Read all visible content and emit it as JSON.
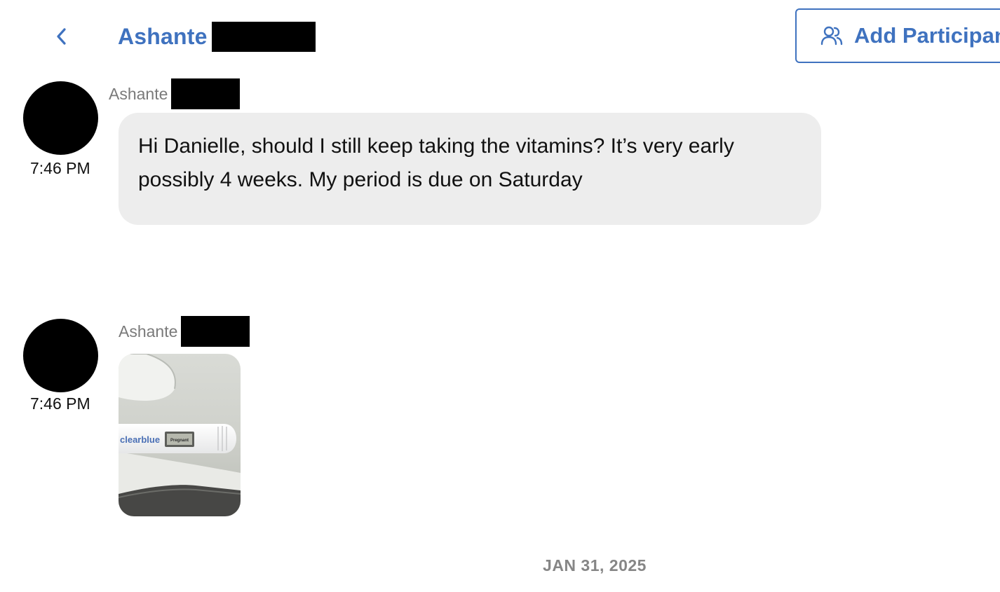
{
  "header": {
    "back_icon": "chevron-left-icon",
    "contact_name": "Ashante",
    "add_participant_icon": "users-icon",
    "add_participant_label": "Add Participant"
  },
  "messages": [
    {
      "sender": "Ashante",
      "time": "7:46 PM",
      "text": "Hi Danielle, should I still keep taking the vitamins? It’s very early possibly 4 weeks. My period is due on Saturday"
    },
    {
      "sender": "Ashante",
      "time": "7:46 PM",
      "attachment": {
        "type": "image",
        "brand_text": "clearblue",
        "display_text": "Pregnant"
      }
    }
  ],
  "date_separator": "JAN 31, 2025",
  "colors": {
    "accent": "#3f72bf",
    "bubble": "#ededed",
    "muted": "#7a7a7a"
  }
}
